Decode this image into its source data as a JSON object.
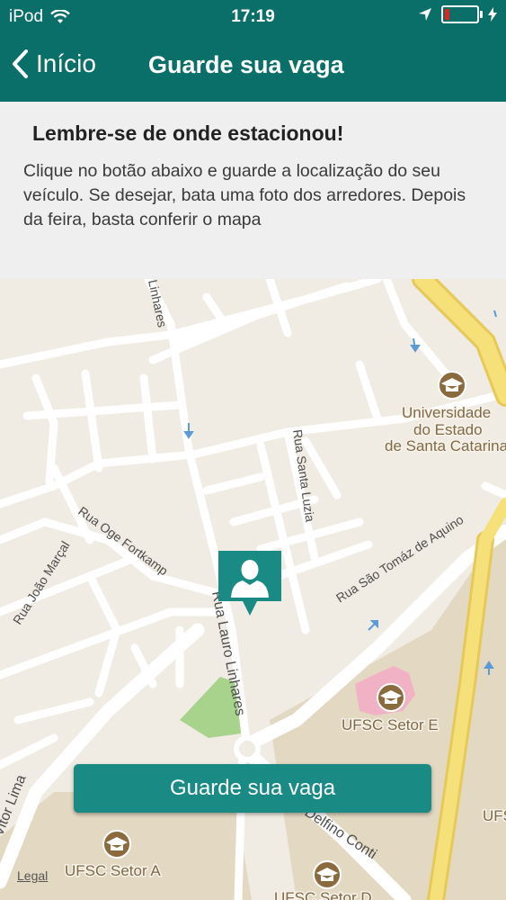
{
  "status_bar": {
    "carrier": "iPod",
    "time": "17:19",
    "battery_level": 0.15
  },
  "nav": {
    "back_label": "Início",
    "title": "Guarde sua vaga"
  },
  "info": {
    "heading": "Lembre-se de onde estacionou!",
    "body": "Clique no botão abaixo e guarde a localização do seu veículo. Se desejar, bata uma foto dos arredores. Depois da feira, basta conferir o mapa"
  },
  "map": {
    "streets": {
      "linhares_top": "Linhares",
      "lauro_linhares": "Rua Lauro Linhares",
      "santa_luzia": "Rua Santa Luzia",
      "oge_fortkamp": "Rua Oge Fortkamp",
      "joao_marcal": "Rua João Marçal",
      "sao_tomaz": "Rua São Tomáz de Aquino",
      "vitor_lima": "Vitor Lima",
      "delfino_conti": "Delfino Conti"
    },
    "pois": {
      "udesc_line1": "Universidade",
      "udesc_line2": "do Estado",
      "udesc_line3": "de Santa Catarina",
      "ufsc_e": "UFSC Setor E",
      "ufsc_a": "UFSC Setor A",
      "ufsc_d": "UFSC Setor D",
      "ufsc_right": "UFS"
    },
    "legal_label": "Legal"
  },
  "save_button_label": "Guarde sua vaga",
  "colors": {
    "header": "#0b6f69",
    "button": "#1a8b84",
    "map_bg": "#f0ece3",
    "campus": "#e3d8c1",
    "highway": "#f1d86a"
  }
}
